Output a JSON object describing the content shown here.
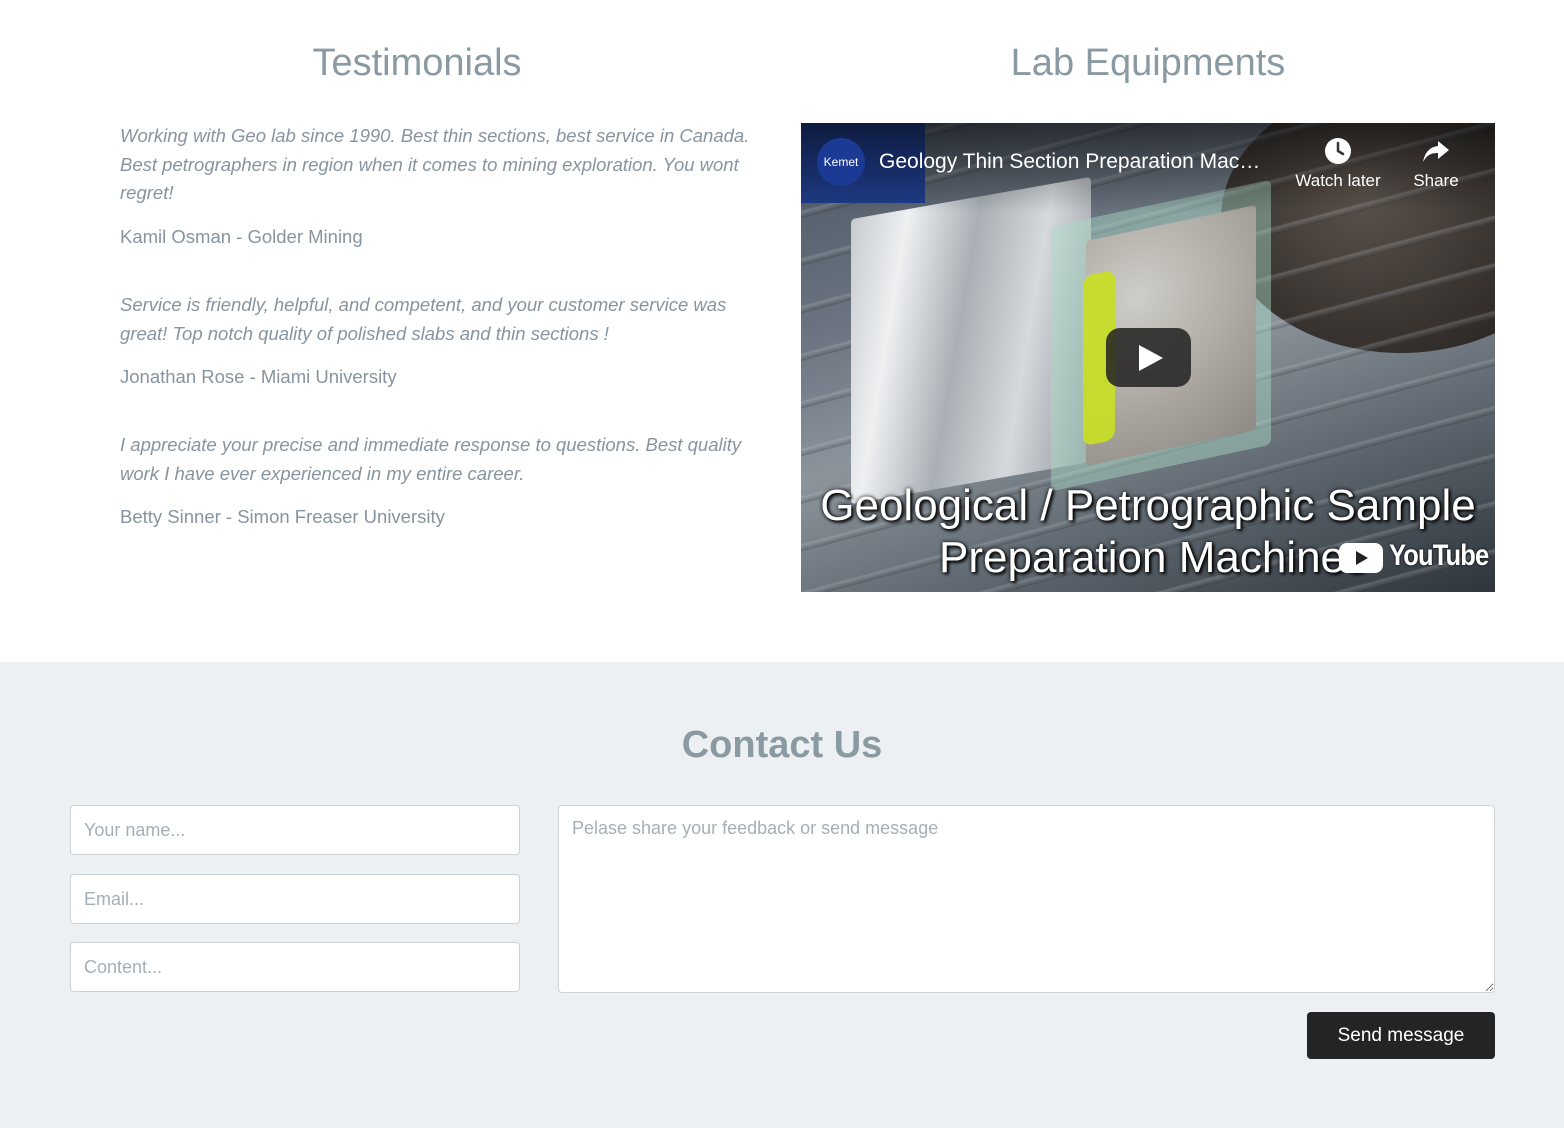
{
  "testimonials": {
    "title": "Testimonials",
    "items": [
      {
        "quote": "Working with Geo lab since 1990. Best thin sections, best service in Canada. Best petrographers in region when it comes to mining exploration. You wont regret!",
        "author": "Kamil Osman - Golder Mining"
      },
      {
        "quote": "Service is friendly, helpful, and competent, and your customer service was great! Top notch quality of polished slabs and thin sections !",
        "author": "Jonathan Rose - Miami University"
      },
      {
        "quote": "I appreciate your precise and immediate response to questions. Best quality work I have ever experienced in my entire career.",
        "author": "Betty Sinner - Simon Freaser University"
      }
    ]
  },
  "lab": {
    "title": "Lab Equipments",
    "video": {
      "channel_logo": "Kemet",
      "title": "Geology Thin Section Preparation Mac…",
      "watch_later": "Watch later",
      "share": "Share",
      "caption_line1": "Geological / Petrographic Sample",
      "caption_line2": "Preparation Machines",
      "brand": "YouTube",
      "icons": [
        "clock-icon",
        "share-arrow-icon",
        "play-icon",
        "youtube-logo-icon"
      ]
    }
  },
  "contact": {
    "title": "Contact Us",
    "name_placeholder": "Your name...",
    "email_placeholder": "Email...",
    "content_placeholder": "Content...",
    "message_placeholder": "Pelase share your feedback or send message",
    "send_label": "Send message"
  },
  "colors": {
    "heading": "#8a9aa3",
    "text": "#8794a0",
    "contact_bg": "#ecf0f2",
    "button_bg": "#222426",
    "youtube_red": "#ff0000"
  }
}
